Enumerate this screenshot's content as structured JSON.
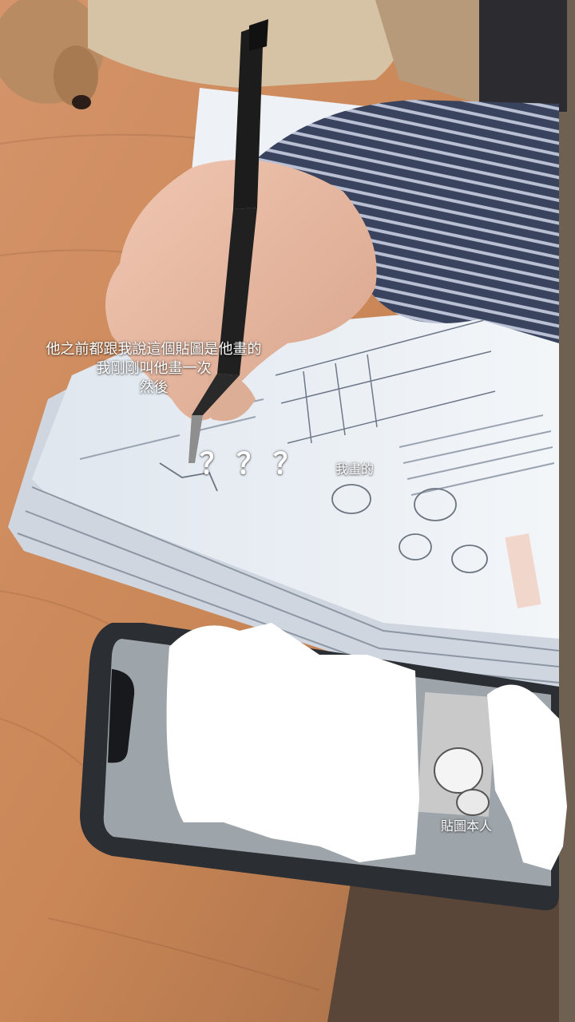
{
  "captions": {
    "line1": "他之前都跟我說這個貼圖是他畫的",
    "line2": "我剛剛叫他畫一次",
    "line3": "然後",
    "questions": "？？？",
    "my_drawing": "我畫的",
    "sticker_person": "貼圖本人"
  },
  "colors": {
    "desk": "#c98656",
    "paper": "#e9eef4",
    "sleeve": "#3c4661",
    "skin": "#e8b89f",
    "pen": "#1c1c1c",
    "text": "#ffffff"
  }
}
